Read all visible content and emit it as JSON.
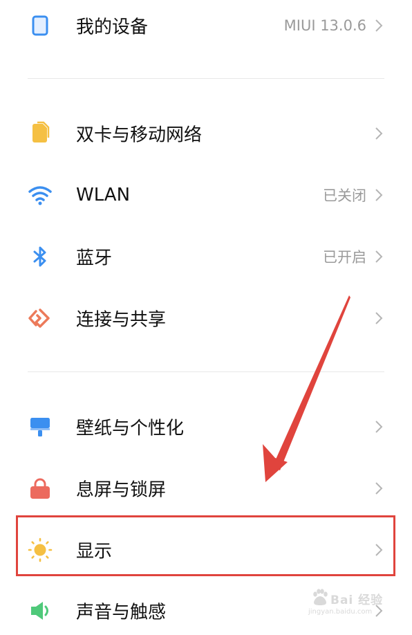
{
  "settings": {
    "my_device": {
      "label": "我的设备",
      "value": "MIUI 13.0.6",
      "icon": "phone-icon"
    },
    "group_network": [
      {
        "label": "双卡与移动网络",
        "value": "",
        "icon": "sim-card-icon"
      },
      {
        "label": "WLAN",
        "value": "已关闭",
        "icon": "wifi-icon"
      },
      {
        "label": "蓝牙",
        "value": "已开启",
        "icon": "bluetooth-icon"
      },
      {
        "label": "连接与共享",
        "value": "",
        "icon": "connection-share-icon"
      }
    ],
    "group_personal": [
      {
        "label": "壁纸与个性化",
        "value": "",
        "icon": "wallpaper-icon"
      },
      {
        "label": "息屏与锁屏",
        "value": "",
        "icon": "lock-icon"
      },
      {
        "label": "显示",
        "value": "",
        "icon": "sun-icon"
      },
      {
        "label": "声音与触感",
        "value": "",
        "icon": "speaker-icon"
      }
    ]
  },
  "annotation": {
    "highlighted_item": "显示",
    "color": "#e0443d"
  },
  "watermark": {
    "text": "Bai 经验",
    "sub": "jingyan.baidu.com"
  },
  "colors": {
    "accent_blue": "#3b8ff0",
    "sim_yellow": "#f5c043",
    "connect_orange": "#ec7a5a",
    "wallpaper_blue": "#3b8ff0",
    "lock_red": "#ec6a5e",
    "sun_yellow": "#f5c043",
    "sound_green": "#4fc97a"
  }
}
